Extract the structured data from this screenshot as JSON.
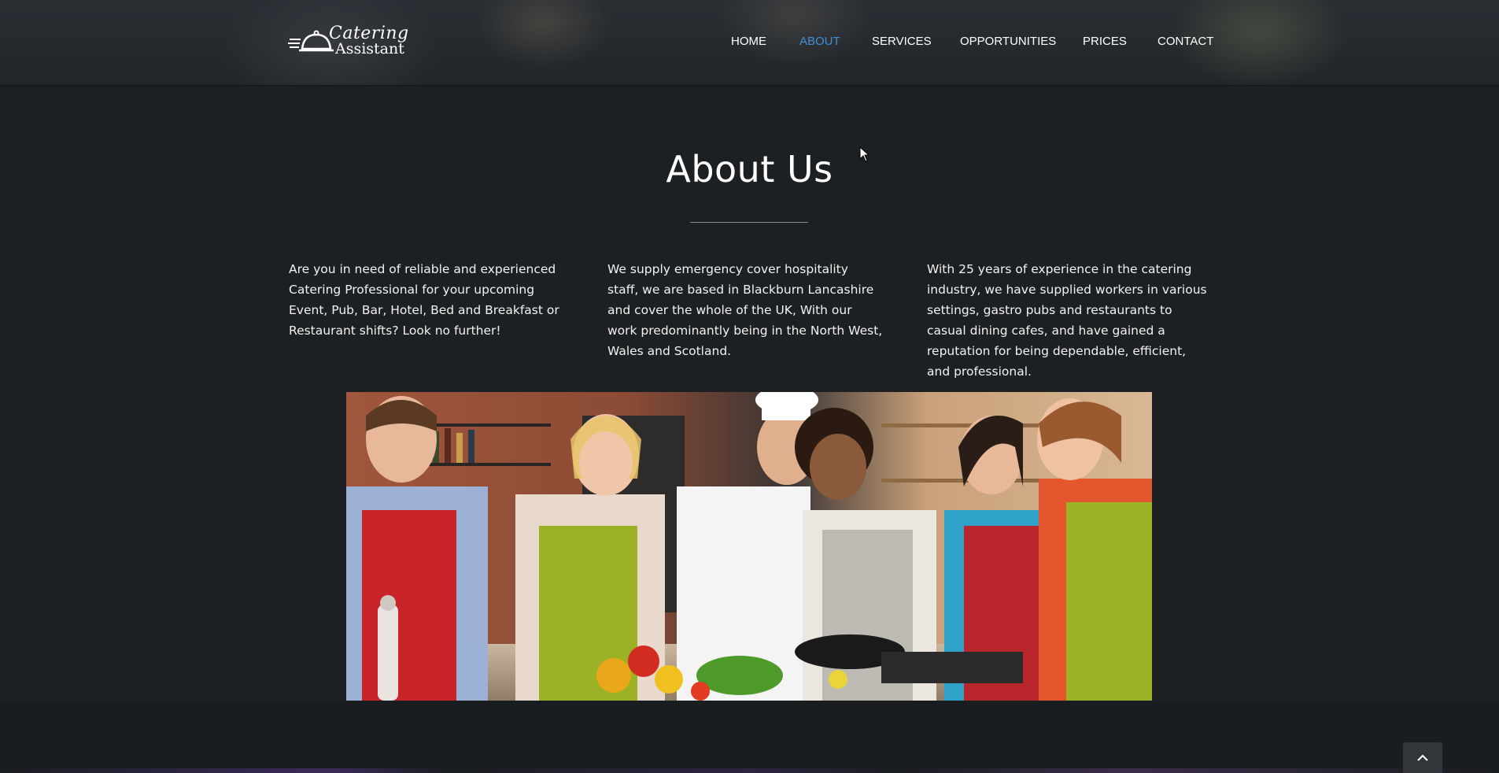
{
  "header": {
    "logo": {
      "line1": "Catering",
      "line2": "Assistant"
    },
    "nav": [
      {
        "label": "HOME",
        "active": false
      },
      {
        "label": "ABOUT",
        "active": true
      },
      {
        "label": "SERVICES",
        "active": false
      },
      {
        "label": "OPPORTUNITIES",
        "active": false
      },
      {
        "label": "PRICES",
        "active": false
      },
      {
        "label": "CONTACT",
        "active": false
      }
    ],
    "accent_color": "#3d8fd6"
  },
  "about": {
    "title": "About Us",
    "columns": [
      "Are you in need of reliable and experienced Catering Professional for your upcoming Event, Pub, Bar, Hotel, Bed and Breakfast or Restaurant shifts? Look no further!",
      "We supply emergency cover hospitality staff, we are based in Blackburn Lancashire and cover the whole of the UK, With our work predominantly being in the North West, Wales and Scotland.",
      "With 25 years of experience in the catering industry, we have supplied workers in various settings, gastro pubs and restaurants to casual dining cafes, and have gained a reputation for being dependable, efficient, and professional."
    ]
  },
  "icons": {
    "logo": "cloche-icon",
    "scroll_top": "chevron-up-icon"
  }
}
